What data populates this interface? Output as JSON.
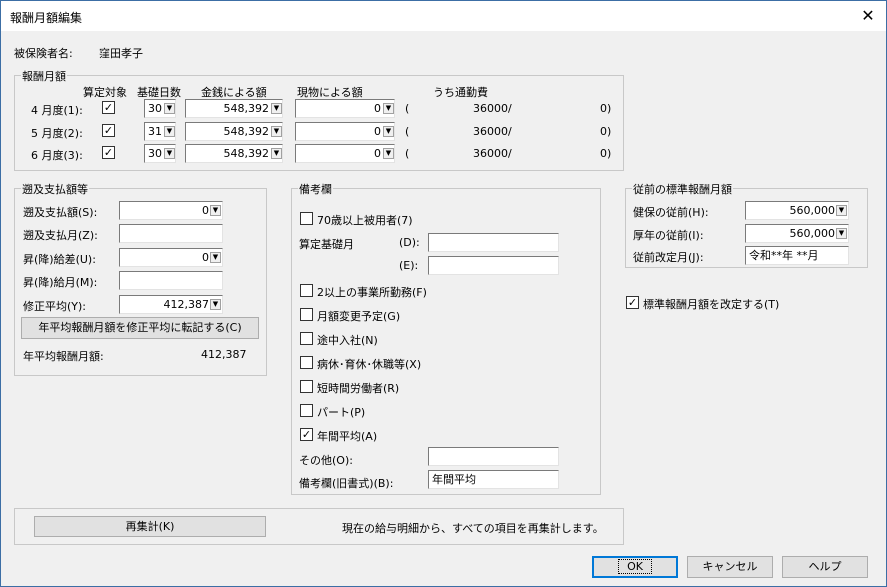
{
  "window": {
    "title": "報酬月額編集"
  },
  "insured": {
    "label": "被保険者名:",
    "name": "窪田孝子"
  },
  "monthly": {
    "title": "報酬月額",
    "headers": {
      "santei": "算定対象",
      "kiso": "基礎日数",
      "kingaku": "金銭による額",
      "genbutsu": "現物による額",
      "tsukin": "うち通勤費"
    },
    "rows": [
      {
        "month": "4 月度(1):",
        "days": "30",
        "money": "548,392",
        "goods": "0",
        "paren_open": "(",
        "commute": "36000",
        "slash": "/",
        "other": "0)"
      },
      {
        "month": "5 月度(2):",
        "days": "31",
        "money": "548,392",
        "goods": "0",
        "paren_open": "(",
        "commute": "36000",
        "slash": "/",
        "other": "0)"
      },
      {
        "month": "6 月度(3):",
        "days": "30",
        "money": "548,392",
        "goods": "0",
        "paren_open": "(",
        "commute": "36000",
        "slash": "/",
        "other": "0)"
      }
    ]
  },
  "retro": {
    "title": "遡及支払額等",
    "amount_label": "遡及支払額(S):",
    "amount_value": "0",
    "month_label": "遡及支払月(Z):",
    "month_value": "",
    "diff_label": "昇(降)給差(U):",
    "diff_value": "0",
    "raise_label": "昇(降)給月(M):",
    "raise_value": "",
    "avg_label": "修正平均(Y):",
    "avg_value": "412,387",
    "transfer_button": "年平均報酬月額を修正平均に転記する(C)",
    "annual_label": "年平均報酬月額:",
    "annual_value": "412,387"
  },
  "remarks": {
    "title": "備考欄",
    "over70": "70歳以上被用者(7)",
    "kiso_month": "算定基礎月",
    "d_label": "(D):",
    "d_value": "",
    "e_label": "(E):",
    "e_value": "",
    "multi_office": "2以上の事業所勤務(F)",
    "change_planned": "月額変更予定(G)",
    "mid_join": "途中入社(N)",
    "leave": "病休･育休･休職等(X)",
    "short_time": "短時間労働者(R)",
    "part": "パート(P)",
    "annual_avg": "年間平均(A)",
    "other_label": "その他(O):",
    "other_value": "",
    "old_label": "備考欄(旧書式)(B):",
    "old_value": "年間平均"
  },
  "prev": {
    "title": "従前の標準報酬月額",
    "health_label": "健保の従前(H):",
    "health_value": "560,000",
    "pension_label": "厚年の従前(I):",
    "pension_value": "560,000",
    "revised_label": "従前改定月(J):",
    "revised_value": "令和**年 **月",
    "revise_check": "標準報酬月額を改定する(T)"
  },
  "recalc": {
    "button": "再集計(K)",
    "note": "現在の給与明細から、すべての項目を再集計します。"
  },
  "footer": {
    "ok": "OK",
    "cancel": "キャンセル",
    "help": "ヘルプ"
  }
}
